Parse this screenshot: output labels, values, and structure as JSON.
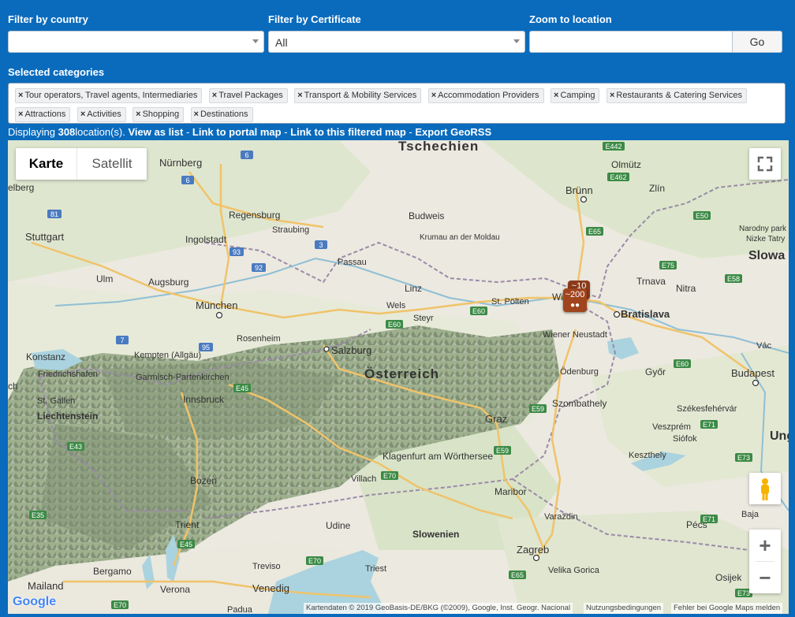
{
  "filters": {
    "country": {
      "label": "Filter by country",
      "value": ""
    },
    "certificate": {
      "label": "Filter by Certificate",
      "value": "All"
    },
    "zoom": {
      "label": "Zoom to location",
      "value": "",
      "button": "Go"
    }
  },
  "categories": {
    "label": "Selected categories",
    "remove_glyph": "×",
    "tags": [
      "Tour operators, Travel agents, Intermediaries",
      "Travel Packages",
      "Transport & Mobility Services",
      "Accommodation Providers",
      "Camping",
      "Restaurants & Catering Services",
      "Attractions",
      "Activities",
      "Shopping",
      "Destinations"
    ]
  },
  "status": {
    "prefix": "Displaying ",
    "count": "308",
    "suffix": "location(s). ",
    "view_list": "View as list",
    "sep": " - ",
    "portal_map": "Link to portal map",
    "filtered_map": "Link to this filtered map",
    "export": "Export GeoRSS"
  },
  "map": {
    "type_buttons": {
      "map": "Karte",
      "satellite": "Satellit"
    },
    "clusters": {
      "back": "~10",
      "front": "~200"
    },
    "zoom_in": "+",
    "zoom_out": "−",
    "google_logo": "Google",
    "attribution": "Kartendaten © 2019 GeoBasis-DE/BKG (©2009), Google, Inst. Geogr. Nacional",
    "terms": "Nutzungsbedingungen",
    "report": "Fehler bei Google Maps melden",
    "cities": [
      "Nürnberg",
      "Regensburg",
      "Straubing",
      "Ingolstadt",
      "Stuttgart",
      "Ulm",
      "Augsburg",
      "München",
      "Passau",
      "Linz",
      "Wels",
      "Steyr",
      "St. Pölten",
      "Wien",
      "Bratislava",
      "Brünn",
      "Budweis",
      "Krumau an der Moldau",
      "Olmütz",
      "Zlín",
      "Trnava",
      "Nitra",
      "Rosenheim",
      "Salzburg",
      "Kempten (Allgäu)",
      "Konstanz",
      "Friedrichshafen",
      "Garmisch-Partenkirchen",
      "Innsbruck",
      "St. Gallen",
      "Liechtenstein",
      "Österreich",
      "Tschechien",
      "Wiener Neustadt",
      "Ödenburg",
      "Győr",
      "Budapest",
      "Szombathely",
      "Székesfehérvár",
      "Graz",
      "Klagenfurt am Wörthersee",
      "Villach",
      "Maribor",
      "Veszprém",
      "Siófok",
      "Keszthely",
      "Bozen",
      "Trient",
      "Udine",
      "Slowenien",
      "Zagreb",
      "Varaždin",
      "Pécs",
      "Baja",
      "Bergamo",
      "Mailand",
      "Verona",
      "Venedig",
      "Treviso",
      "Triest",
      "Velika Gorica",
      "Osijek",
      "Padua",
      "Slowa",
      "Unga",
      "Vác",
      "Nizke Tatry",
      "Narodny park",
      "elberg",
      "ch"
    ],
    "roads": [
      "6",
      "6",
      "81",
      "93",
      "92",
      "3",
      "7",
      "95",
      "E442",
      "E462",
      "E65",
      "E50",
      "E75",
      "E58",
      "E60",
      "E60",
      "E45",
      "E43",
      "E59",
      "E59",
      "E71",
      "E73",
      "E35",
      "E45",
      "E70",
      "E70",
      "E70",
      "E65",
      "E73",
      "E60",
      "E71"
    ]
  }
}
